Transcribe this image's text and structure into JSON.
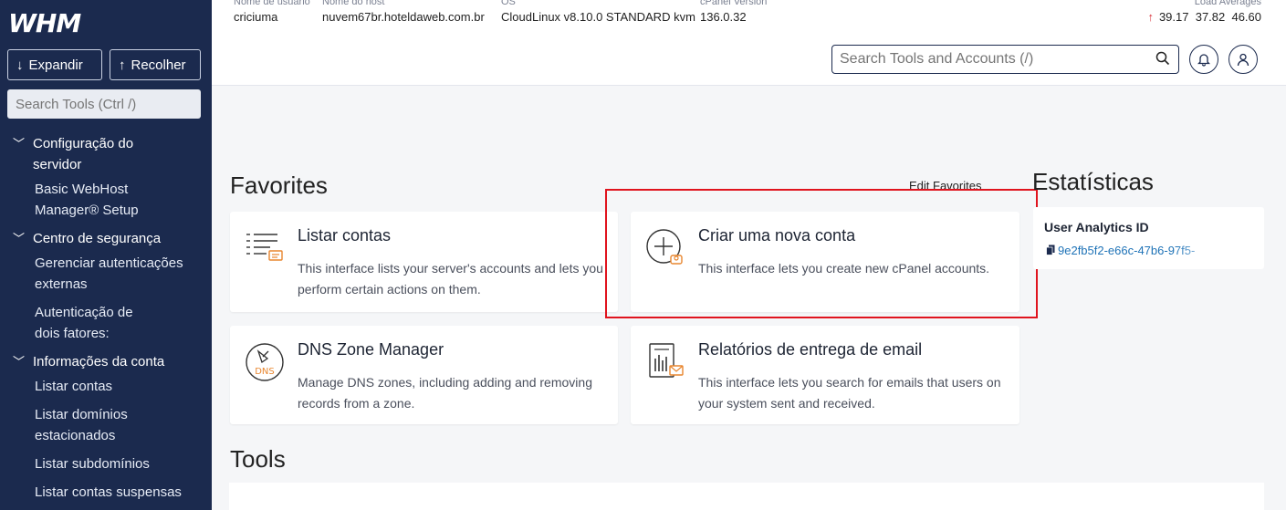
{
  "sidebar": {
    "logo": "WHM",
    "expand_label": "Expandir",
    "collapse_label": "Recolher",
    "search_placeholder": "Search Tools (Ctrl /)",
    "sections": [
      {
        "label": "Configuração do servidor",
        "items": [
          "Basic WebHost Manager® Setup"
        ]
      },
      {
        "label": "Centro de segurança",
        "items": [
          "Gerenciar autenticações externas",
          "Autenticação de dois fatores:"
        ]
      },
      {
        "label": "Informações da conta",
        "items": [
          "Listar contas",
          "Listar domínios estacionados",
          "Listar subdomínios",
          "Listar contas suspensas"
        ]
      }
    ]
  },
  "header": {
    "info": [
      {
        "label": "Nome de usuário",
        "value": "criciuma"
      },
      {
        "label": "Nome do host",
        "value": "nuvem67br.hoteldaweb.com.br"
      },
      {
        "label": "OS",
        "value": "CloudLinux v8.10.0 STANDARD kvm"
      },
      {
        "label": "cPanel Version",
        "value": "136.0.32"
      }
    ],
    "load_label": "Load Averages",
    "load_values": "39.17  37.82  46.60",
    "search_placeholder": "Search Tools and Accounts (/)"
  },
  "favorites": {
    "heading": "Favorites",
    "edit_label": "Edit Favorites",
    "cards": [
      {
        "title": "Listar contas",
        "desc": "This interface lists your server's accounts and lets you perform certain actions on them."
      },
      {
        "title": "Criar uma nova conta",
        "desc": "This interface lets you create new cPanel accounts."
      },
      {
        "title": "DNS Zone Manager",
        "desc": "Manage DNS zones, including adding and removing records from a zone."
      },
      {
        "title": "Relatórios de entrega de email",
        "desc": "This interface lets you search for emails that users on your system sent and received."
      }
    ]
  },
  "stats": {
    "heading": "Estatísticas",
    "label": "User Analytics ID",
    "value": "9e2fb5f2-e66c-47b6-97f5-"
  },
  "tools": {
    "heading": "Tools"
  },
  "icon_text": {
    "dns": "DNS"
  },
  "colors": {
    "sidebar": "#1b2a4e",
    "accent": "#e8862f",
    "link": "#1f73b7",
    "highlight": "#e0141e"
  }
}
